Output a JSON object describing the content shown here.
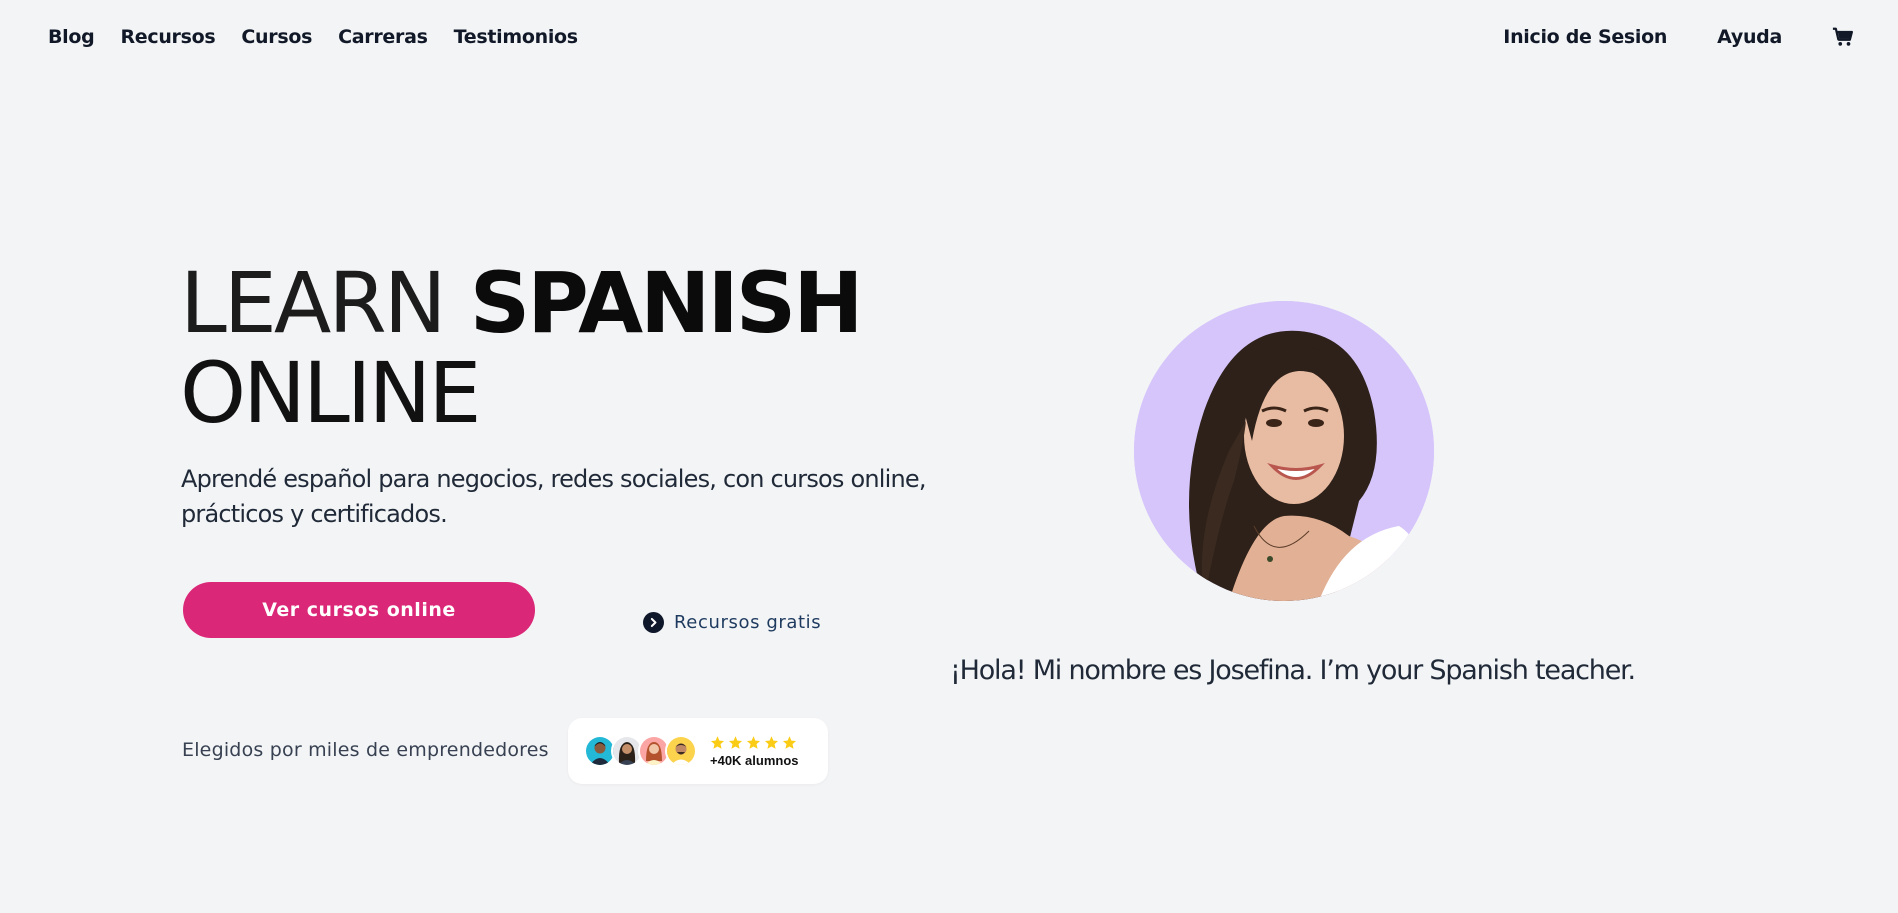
{
  "nav": {
    "left_items": [
      "Blog",
      "Recursos",
      "Cursos",
      "Carreras",
      "Testimonios"
    ],
    "login": "Inicio de Sesion",
    "help": "Ayuda",
    "cart_icon": "cart-icon"
  },
  "hero": {
    "title_word1": "LEARN",
    "title_word2": "SPANISH",
    "title_word3": "ONLINE",
    "subtitle": "Aprendé español para negocios, redes sociales, con cursos online, prácticos y certificados.",
    "cta_label": "Ver cursos online",
    "resources_label": "Recursos gratis"
  },
  "social_proof": {
    "chosen_text": "Elegidos por miles de emprendedores",
    "stars": 5,
    "students": "+40K alumnos"
  },
  "teacher": {
    "intro": "¡Hola! Mi nombre es Josefina. I’m your Spanish teacher."
  },
  "colors": {
    "background": "#f3f4f6",
    "cta": "#db2777",
    "star": "#facc15",
    "photo_bg": "#d6c5fb"
  }
}
